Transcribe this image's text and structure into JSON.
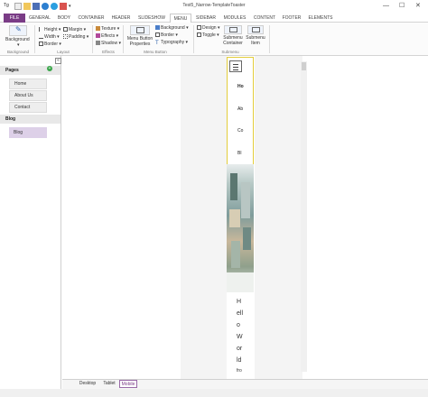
{
  "window": {
    "title": "Test5_Narrow-TemplateToaster",
    "app_icon_text": "Tg",
    "min_symbol": "—",
    "max_symbol": "☐",
    "close_symbol": "✕"
  },
  "tabs": {
    "file": "FILE",
    "items": [
      "GENERAL",
      "BODY",
      "CONTAINER",
      "HEADER",
      "SLIDESHOW",
      "MENU",
      "SIDEBAR",
      "MODULES",
      "CONTENT",
      "FOOTER",
      "ELEMENTS"
    ],
    "active": "MENU"
  },
  "ribbon": {
    "background": {
      "label": "Background",
      "group": "Background"
    },
    "layout": {
      "height": "Height",
      "width": "Width",
      "margin": "Margin",
      "padding": "Padding",
      "border": "Border",
      "group": "Layout"
    },
    "effects": {
      "texture": "Texture",
      "effects": "Effects",
      "shadow": "Shadow",
      "group": "Effects"
    },
    "menu_button": {
      "properties_line1": "Menu Button",
      "properties_line2": "Properties",
      "background": "Background",
      "border": "Border",
      "typography": "Typography",
      "group": "Menu Button"
    },
    "submenu": {
      "design": "Design",
      "toggle": "Toggle",
      "container_line1": "Submenu",
      "container_line2": "Container",
      "item_line1": "Submenu",
      "item_line2": "Item",
      "group": "Submenu"
    }
  },
  "sidebar": {
    "collapse_symbol": "«",
    "pages_header": "Pages",
    "add_symbol": "+",
    "pages": [
      "Home",
      "About Us",
      "Contact"
    ],
    "blog_header": "Blog",
    "blog_items": [
      "Blog"
    ]
  },
  "preview": {
    "menu_items": [
      "Ho",
      "Ab",
      "Co",
      "Bl"
    ],
    "hello_letters": [
      "H",
      "ell",
      "o",
      "W",
      "or",
      "ld",
      "fro"
    ]
  },
  "view_tabs": {
    "items": [
      "Desktop",
      "Tablet",
      "Mobile"
    ],
    "active": "Mobile"
  },
  "colors": {
    "accent": "#7a3c86",
    "selection_outline": "#e3cd3a",
    "add_green": "#3aa64a",
    "blog_highlight": "#ddd0e8"
  }
}
